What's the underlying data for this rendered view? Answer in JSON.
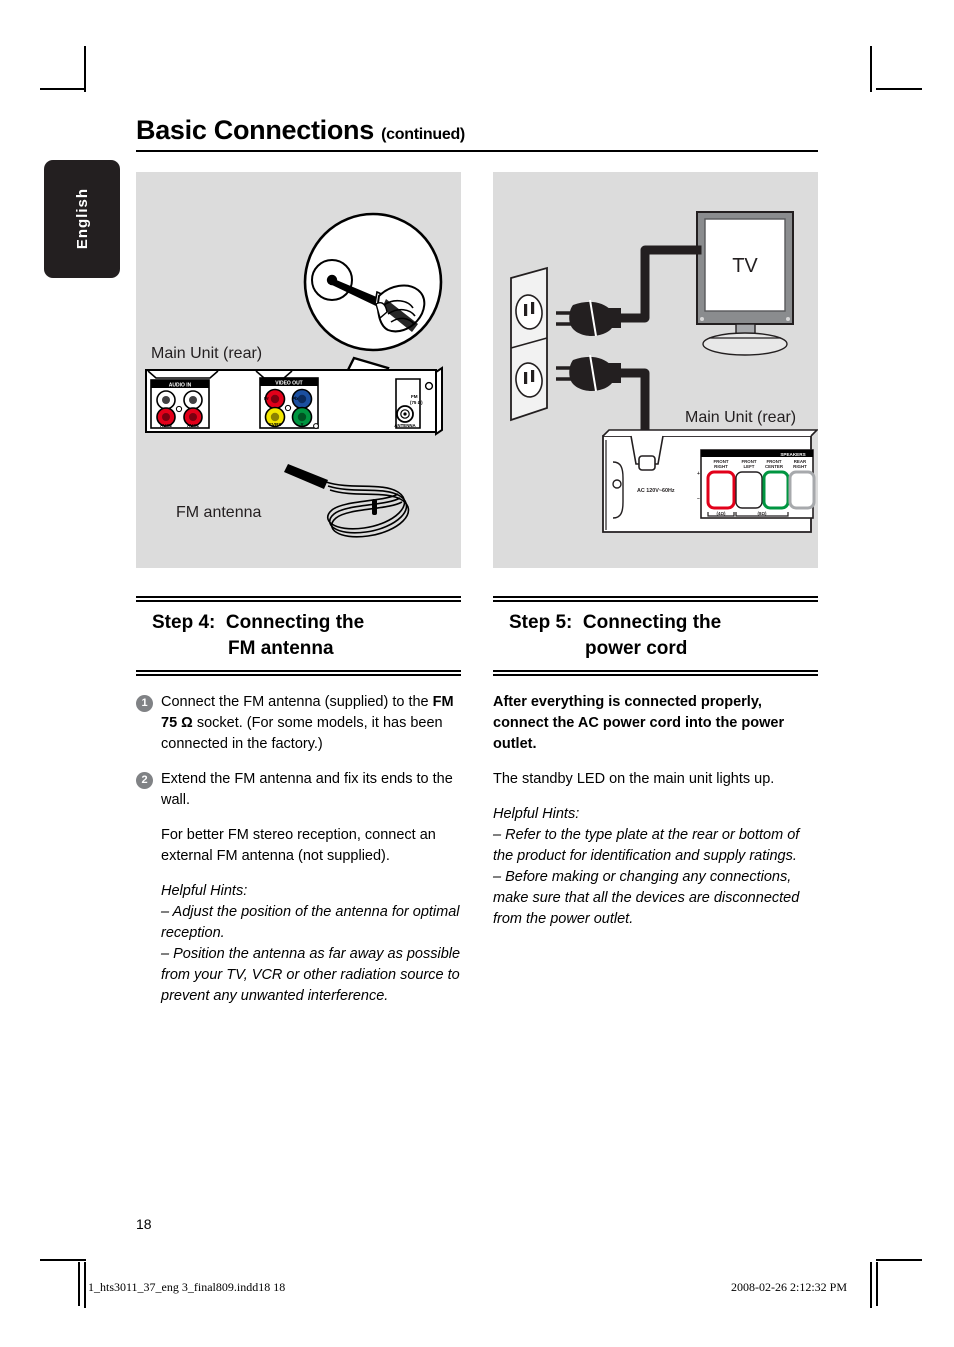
{
  "language_tab": {
    "label": "English"
  },
  "header": {
    "title": "Basic Connections",
    "continued": "(continued)"
  },
  "figures": {
    "left": {
      "caption_unit": "Main Unit (rear)",
      "caption_antenna": "FM antenna",
      "panel_labels": {
        "audio_in": "AUDIO IN",
        "aux2": "AUX2",
        "aux1": "AUX1",
        "video_out": "VIDEO OUT",
        "pr": "Pr",
        "pb": "Pb",
        "cvbs": "CVBS",
        "y": "Y",
        "fm": "FM",
        "impedance": "(75 Ω)",
        "antenna": "ANTENNA"
      }
    },
    "right": {
      "tv_label": "TV",
      "caption_unit": "Main Unit (rear)",
      "panel_labels": {
        "ac_rating": "AC 120V~60Hz",
        "speakers": "SPEAKERS",
        "front_right": "FRONT\nRIGHT",
        "front_left": "FRONT\nLEFT",
        "front_center": "FRONT\nCENTER",
        "rear_right": "REAR\nRIGHT",
        "ohm_4": "(4Ω)",
        "ohm_8": "(8Ω)"
      }
    }
  },
  "step4": {
    "label": "Step 4:",
    "title_line1": "Connecting the",
    "title_line2": "FM antenna",
    "items": [
      {
        "number": "1",
        "text_before": "Connect the FM antenna (supplied) to the ",
        "bold": "FM 75 Ω",
        "text_after": " socket. (For some models, it has been connected in the factory.)"
      },
      {
        "number": "2",
        "text_before": "Extend the FM antenna and fix its ends to the wall.",
        "bold": "",
        "text_after": ""
      }
    ],
    "paragraph": "For better FM stereo reception, connect an external FM antenna (not supplied).",
    "hints_title": "Helpful Hints:",
    "hints": [
      "– Adjust the position of the antenna for optimal reception.",
      "– Position the antenna as far away as possible from your TV, VCR or other radiation source to prevent any unwanted interference."
    ]
  },
  "step5": {
    "label": "Step 5:",
    "title_line1": "Connecting the",
    "title_line2": "power cord",
    "bold_paragraph": "After everything is connected properly, connect the AC power cord into the power outlet.",
    "paragraph": "The standby LED on the main unit lights up.",
    "hints_title": "Helpful Hints:",
    "hints": [
      "– Refer to the type plate at the rear or bottom of the product for identification and supply ratings.",
      "– Before making or changing any connections, make sure that all the devices are disconnected from the power outlet."
    ]
  },
  "page": {
    "number": "18",
    "footer_file": "1_hts3011_37_eng 3_final809.indd18   18",
    "footer_date": "2008-02-26   2:12:32 PM"
  },
  "colors": {
    "figure_bg": "#dcdcdc",
    "bullet": "#808285",
    "tab_bg": "#231f20"
  }
}
